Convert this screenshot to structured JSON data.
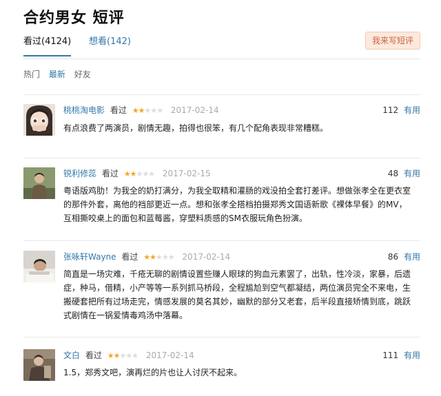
{
  "header": {
    "title": "合约男女 短评"
  },
  "tabs": [
    {
      "label": "看过(4124)",
      "active": true
    },
    {
      "label": "想看(142)",
      "active": false
    }
  ],
  "write_button": "我来写短评",
  "sort_options": [
    {
      "label": "热门",
      "active": false
    },
    {
      "label": "最新",
      "active": true
    },
    {
      "label": "好友",
      "active": false
    }
  ],
  "star_colors": {
    "on": "#f5a623",
    "off": "#dddddd"
  },
  "reviews": [
    {
      "author": "桃桃淘电影",
      "status": "看过",
      "rating": 2,
      "date": "2017-02-14",
      "votes": "112",
      "vote_label": "有用",
      "content": "有点浪费了两演员，剧情无趣，拍得也很笨，有几个配角表现非常糟糕。"
    },
    {
      "author": "锐利修蕊",
      "status": "看过",
      "rating": 2,
      "date": "2017-02-15",
      "votes": "48",
      "vote_label": "有用",
      "content": "粤语版鸡肋！为我全的奶打满分，为我全取精和灌肠的戏没拍全套打差评。想做张孝全在更衣室的那件外套，离他的裆部更近一点。想和张孝全搭档拍摄郑秀文国语新歌《裸体早餐》的MV，互相撕咬桌上的面包和蓝莓酱，穿塑料质感的SM衣服玩角色扮演。"
    },
    {
      "author": "张咏轩Wayne",
      "status": "看过",
      "rating": 2,
      "date": "2017-02-14",
      "votes": "86",
      "vote_label": "有用",
      "content": "简直是一场灾难，千疮无聊的剧情设置些赚人眼球的狗血元素罢了，出轨，性冷淡，家暴，后遗症，种马，借精，小产等等一系列抓马桥段，全程尴尬到空气都凝结，两位演员完全不来电，生搬硬套把所有过场走完，情感发展的莫名其妙，幽默的部分又老套，后半段直接矫情到底，跳跃式剧情在一锅爱情毒鸡汤中落幕。"
    },
    {
      "author": "文白",
      "status": "看过",
      "rating": 2,
      "date": "2017-02-14",
      "votes": "111",
      "vote_label": "有用",
      "content": "1.5，郑秀文吧，演再烂的片也让人讨厌不起来。"
    }
  ]
}
